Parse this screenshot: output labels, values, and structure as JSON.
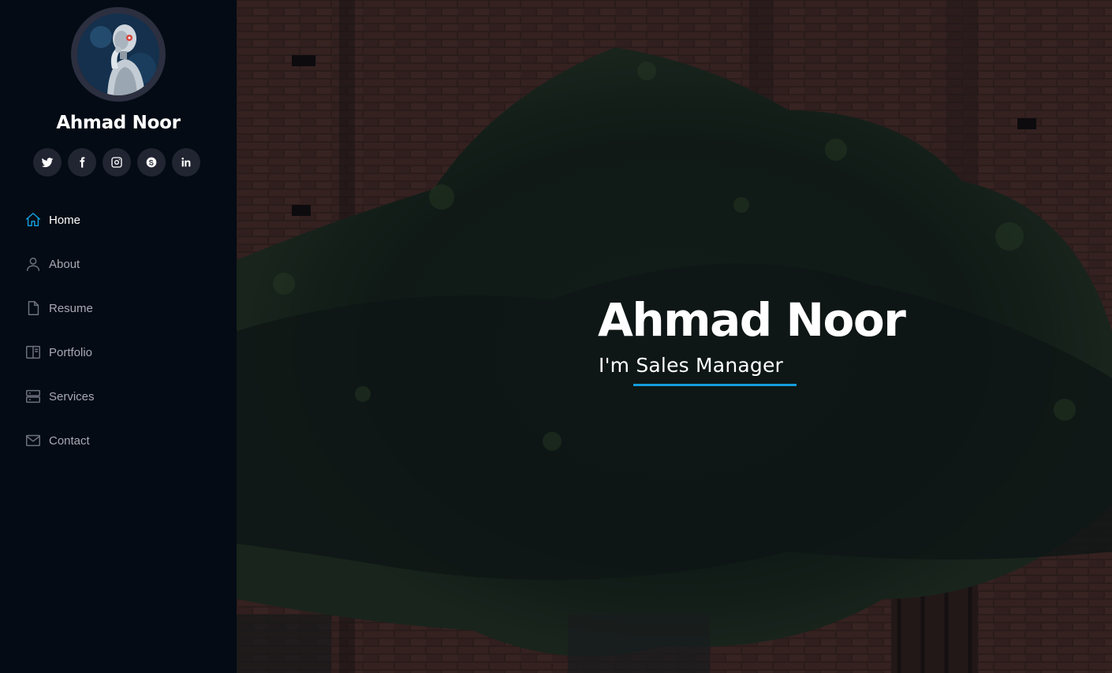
{
  "profile": {
    "name": "Ahmad Noor",
    "avatar_icon": "robot-thinker-avatar"
  },
  "social": [
    {
      "icon": "twitter-icon"
    },
    {
      "icon": "facebook-icon"
    },
    {
      "icon": "instagram-icon"
    },
    {
      "icon": "skype-icon"
    },
    {
      "icon": "linkedin-icon"
    }
  ],
  "nav": {
    "items": [
      {
        "label": "Home",
        "icon": "home-icon",
        "active": true
      },
      {
        "label": "About",
        "icon": "person-icon",
        "active": false
      },
      {
        "label": "Resume",
        "icon": "file-icon",
        "active": false
      },
      {
        "label": "Portfolio",
        "icon": "book-icon",
        "active": false
      },
      {
        "label": "Services",
        "icon": "server-icon",
        "active": false
      },
      {
        "label": "Contact",
        "icon": "envelope-icon",
        "active": false
      }
    ]
  },
  "hero": {
    "title": "Ahmad Noor",
    "subtitle": "I'm Sales Manager"
  },
  "colors": {
    "accent": "#149ddd",
    "sidebar_bg": "#040b14",
    "social_bg": "#212431"
  }
}
